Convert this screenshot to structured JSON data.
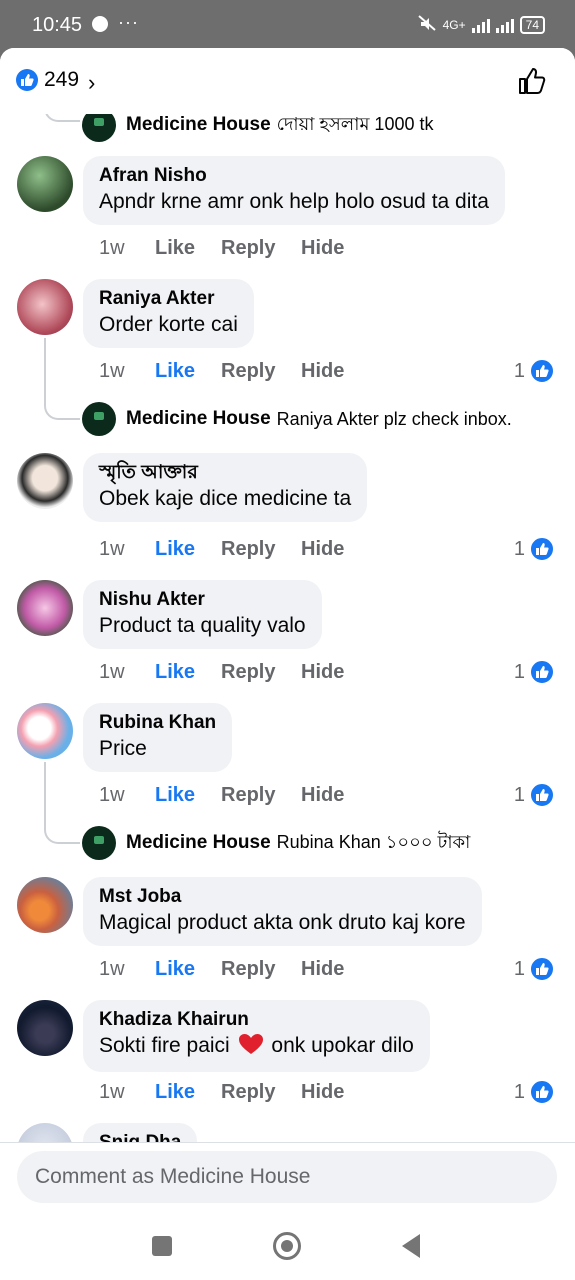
{
  "status": {
    "time": "10:45",
    "dots": "···",
    "net": "4G+",
    "battery": "74"
  },
  "header": {
    "like_count": "249",
    "chevron": "›"
  },
  "top_reply": {
    "name": "Medicine House",
    "text": "দোয়া হসলাম 1000 tk"
  },
  "comments": [
    {
      "name": "Afran Nisho",
      "text": "Apndr krne amr onk help holo osud ta dita",
      "time": "1w",
      "like": "Like",
      "reply": "Reply",
      "hide": "Hide",
      "reactions": ""
    },
    {
      "name": "Raniya Akter",
      "text": "Order korte cai",
      "time": "1w",
      "like": "Like",
      "reply": "Reply",
      "hide": "Hide",
      "reactions": "1"
    },
    {
      "name": "স্মৃতি আক্তার",
      "text": "Obek kaje dice medicine ta",
      "time": "1w",
      "like": "Like",
      "reply": "Reply",
      "hide": "Hide",
      "reactions": "1"
    },
    {
      "name": "Nishu Akter",
      "text": "Product ta quality valo",
      "time": "1w",
      "like": "Like",
      "reply": "Reply",
      "hide": "Hide",
      "reactions": "1"
    },
    {
      "name": "Rubina Khan",
      "text": "Price",
      "time": "1w",
      "like": "Like",
      "reply": "Reply",
      "hide": "Hide",
      "reactions": "1"
    },
    {
      "name": "Mst Joba",
      "text": "Magical product akta onk druto kaj kore",
      "time": "1w",
      "like": "Like",
      "reply": "Reply",
      "hide": "Hide",
      "reactions": "1"
    },
    {
      "name": "Khadiza Khairun",
      "text_before": "Sokti fire paici",
      "text_after": "onk upokar dilo",
      "time": "1w",
      "like": "Like",
      "reply": "Reply",
      "hide": "Hide",
      "reactions": "1"
    },
    {
      "name": "Snig Dha"
    }
  ],
  "replies": [
    {
      "name": "Medicine House",
      "text": "Raniya Akter plz check inbox."
    },
    {
      "name": "Medicine House",
      "text": "Rubina Khan ১০০০ টাকা"
    }
  ],
  "composer": {
    "placeholder": "Comment as Medicine House"
  },
  "colors": {
    "accent": "#1877f2",
    "bubble": "#f0f2f5",
    "muted": "#65676b"
  }
}
